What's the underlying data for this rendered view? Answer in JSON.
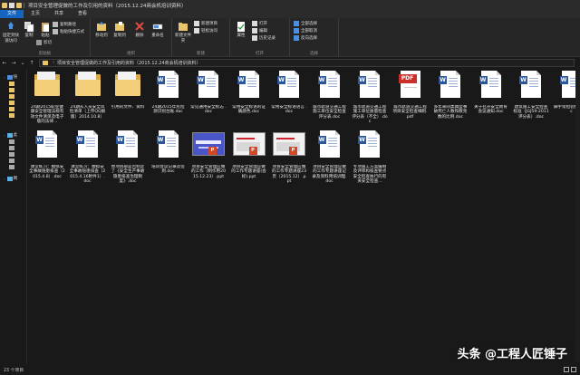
{
  "window": {
    "title": "项目安全管理促做的工作及引用的资料（2015.12.24商会机培训资料）"
  },
  "ribbon_tabs": [
    {
      "label": "文件",
      "active": true
    },
    {
      "label": "主页",
      "active": false
    },
    {
      "label": "共享",
      "active": false
    },
    {
      "label": "查看",
      "active": false
    }
  ],
  "ribbon": {
    "pin_label": "固定到快速访问",
    "copy_label": "复制",
    "paste_label": "粘贴",
    "copy_path_label": "复制路径",
    "paste_shortcut_label": "粘贴快捷方式",
    "cut_label": "剪切",
    "clipboard_group": "剪贴板",
    "move_to_label": "移动到",
    "copy_to_label": "复制到",
    "delete_label": "删除",
    "rename_label": "重命名",
    "organize_group": "组织",
    "new_folder_label": "新建文件夹",
    "new_item_label": "新建项目",
    "easy_access_label": "轻松访问",
    "new_group": "新建",
    "properties_label": "属性",
    "open_label": "打开",
    "edit_label": "编辑",
    "history_label": "历史记录",
    "open_group": "打开",
    "select_all_label": "全部选择",
    "select_none_label": "全部取消",
    "invert_label": "反向选择",
    "select_group": "选择"
  },
  "address": {
    "path": [
      "项目安全管理促做的工作及引用的资料（2015.12.24商会机培训资料）"
    ]
  },
  "nav": {
    "items": [
      "快",
      "此",
      "网"
    ]
  },
  "files": [
    {
      "name": "24期2015职业健康安全管理法规有效文件清单及电子版的法律...",
      "icon": "folder"
    },
    {
      "name": "24期从入员安全风险清单（上传QQ群版）2014.10.8）",
      "icon": "folder"
    },
    {
      "name": "引用的文件、资料",
      "icon": "folder"
    },
    {
      "name": "24期2015年危险源识别台账.doc",
      "icon": "word"
    },
    {
      "name": "常见通用安全标志 .doc",
      "icon": "word"
    },
    {
      "name": "常用安全标语的证确颜色.doc",
      "icon": "word"
    },
    {
      "name": "常用安全标语语言 .doc",
      "icon": "word"
    },
    {
      "name": "城市轨道交通工程施工单位安全检查评分表.doc",
      "icon": "word"
    },
    {
      "name": "城市轨道交通工程施工单位质量检查评分表（不全）.doc",
      "icon": "word"
    },
    {
      "name": "城市轨道交通工程项目安全检查细则.pdf",
      "icon": "pdf"
    },
    {
      "name": "多年来同类典型事故死亡人数和教兇数的比例.doc",
      "icon": "word"
    },
    {
      "name": "关于召开安全教育会议通知.doc",
      "icon": "word"
    },
    {
      "name": "建筑施工安全检查标准（JGJ59-2011评分表）.doc",
      "icon": "word"
    },
    {
      "name": "脚手架检验批表.doc",
      "icon": "word"
    },
    {
      "name": "课堂练习：模拟安全事故隐患排查（2015.4.8）.doc",
      "icon": "word"
    },
    {
      "name": "课堂练习：模拟安全事故隐患排查（2015.4.16附件1）.doc",
      "icon": "word"
    },
    {
      "name": "你项目部是否制定了《安全生产事故隐患排查治理制度》.doc",
      "icon": "word"
    },
    {
      "name": "培训会议记录及签到.doc",
      "icon": "word"
    },
    {
      "name": "项目安全管理应做的工作（制作用2015.12.23）.ppt",
      "icon": "ppt-blue"
    },
    {
      "name": "项目安全管理应做的工作专题讲座(会标).ppt",
      "icon": "ppt-white"
    },
    {
      "name": "项目安全管理应做的工作专题讲座23页（2015.12）.ppt",
      "icon": "ppt-white"
    },
    {
      "name": "项目安全管理应做的工作专题讲座记录及资料用培训理.doc",
      "icon": "word"
    },
    {
      "name": "专项施工方案编制及评审和核查要点安全检查执行的有关安全检查...",
      "icon": "word"
    }
  ],
  "status": {
    "item_count": "23 个项目"
  },
  "watermark": {
    "text": "头条 @工程人匠锤子"
  }
}
